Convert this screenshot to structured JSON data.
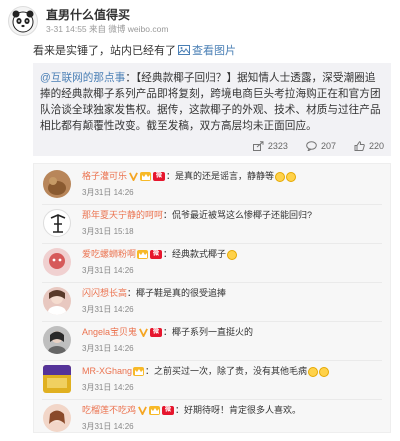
{
  "post": {
    "author": "直男什么值得买",
    "time": "3-31 14:55",
    "source_prefix": "来自",
    "source": "微博 weibo.com",
    "text": "看来是实锤了，站内已经有了",
    "view_pic_label": "查看图片"
  },
  "repost": {
    "mention": "@互联网的那点事",
    "body": "：【经典款椰子回归？】据知情人士透露，深受潮圈追捧的经典款椰子系列产品即将复刻，跨境电商巨头考拉海购正在和官方团队洽谈全球独家发售权。据传，这款椰子的外观、技术、材质与过往产品相比都有颠覆性改变。截至发稿，双方高层均未正面回应。",
    "reposts": "2323",
    "comments": "207",
    "likes": "220"
  },
  "comments": [
    {
      "user": "格子灌可乐",
      "text": "是真的还是谣言，静静等",
      "time": "3月31日 14:26",
      "avatar_color": "#b8865a",
      "vip": true,
      "emoji_count": 2
    },
    {
      "user": "那年夏天宁静的呵呵",
      "text": "侃爷最近被骂这么惨椰子还能回归?",
      "time": "3月31日 15:18",
      "avatar_color": "#ffffff",
      "vip": false,
      "emoji_count": 0
    },
    {
      "user": "爱吃螺蛳粉啊",
      "text": "经典款式椰子",
      "time": "3月31日 14:26",
      "avatar_color": "#d65a5a",
      "vip": true,
      "emoji_count": 1
    },
    {
      "user": "闪闪想长高",
      "text": "椰子鞋是真的很受追捧",
      "time": "3月31日 14:26",
      "avatar_color": "#e8c8c0",
      "vip": false,
      "emoji_count": 0
    },
    {
      "user": "Angela宝贝鬼",
      "text": "椰子系列一直挺火的",
      "time": "3月31日 14:26",
      "avatar_color": "#a0a0a0",
      "vip": true,
      "emoji_count": 0
    },
    {
      "user": "MR-XGhang",
      "text": "之前买过一次，除了贵，没有其他毛病",
      "time": "3月31日 14:26",
      "avatar_color": "#e0b020",
      "vip": true,
      "emoji_count": 2
    },
    {
      "user": "吃榴莲不吃鸡",
      "text": "好期待呀！肯定很多人喜欢。",
      "time": "3月31日 14:26",
      "avatar_color": "#c87a5a",
      "vip": true,
      "emoji_count": 0
    }
  ],
  "colors": {
    "username": "#eb7350",
    "link": "#4a7fb5",
    "repost_bg": "#f2f2f5",
    "comment_bg": "#f7f7f7"
  }
}
